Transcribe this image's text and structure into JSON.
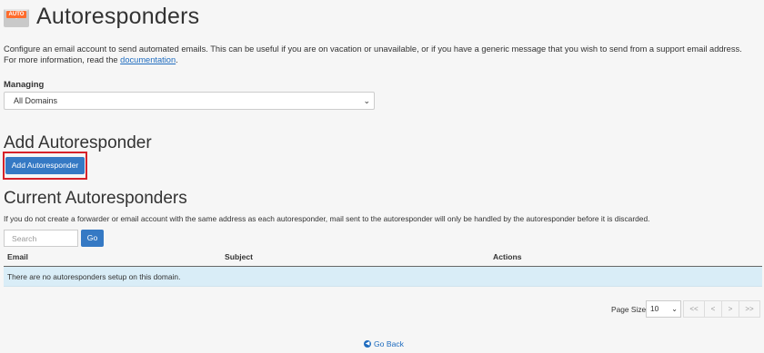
{
  "header": {
    "icon_tag": "AUTO",
    "title": "Autoresponders"
  },
  "intro": {
    "text": "Configure an email account to send automated emails. This can be useful if you are on vacation or unavailable, or if you have a generic message that you wish to send from a support email address. For more information, read the ",
    "link_text": "documentation",
    "suffix": "."
  },
  "managing": {
    "label": "Managing",
    "selected": "All Domains"
  },
  "add_section": {
    "heading": "Add Autoresponder",
    "button_label": "Add Autoresponder"
  },
  "current_section": {
    "heading": "Current Autoresponders",
    "note": "If you do not create a forwarder or email account with the same address as each autoresponder, mail sent to the autoresponder will only be handled by the autoresponder before it is discarded.",
    "search_placeholder": "Search",
    "go_label": "Go"
  },
  "table": {
    "columns": [
      "Email",
      "Subject",
      "Actions"
    ],
    "empty_message": "There are no autoresponders setup on this domain."
  },
  "pagination": {
    "page_size_label": "Page Size",
    "page_size": "10",
    "buttons": [
      "<<",
      "<",
      ">",
      ">>"
    ]
  },
  "footer": {
    "go_back": "Go Back"
  },
  "colors": {
    "primary": "#3579c4",
    "highlight": "#d6222a",
    "row_info": "#d9edf7"
  }
}
